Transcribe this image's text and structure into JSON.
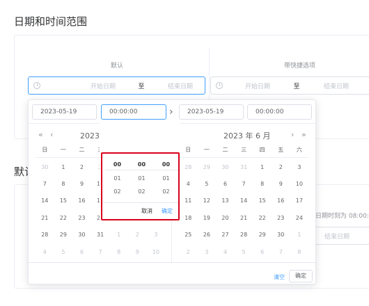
{
  "section1": {
    "title": "日期和时间范围"
  },
  "section2": {
    "title": "默认"
  },
  "demos": {
    "default_label": "默认",
    "shortcut_label": "带快捷选项",
    "start_placeholder": "开始日期",
    "separator": "至",
    "end_placeholder": "结束日期",
    "peek_text": "日期时刻为 08:00:0",
    "peek_end": "结束日期"
  },
  "picker": {
    "start_date": "2023-05-19",
    "start_time": "00:00:00",
    "end_date": "2023-05-19",
    "end_time": "00:00:00",
    "left_title": "2023 年",
    "right_title": "2023 年 6 月",
    "weekdays": [
      "日",
      "一",
      "二",
      "三",
      "四",
      "五",
      "六"
    ],
    "left_grid": [
      [
        "30",
        "1",
        "2",
        "3",
        "4",
        "5",
        "6"
      ],
      [
        "7",
        "8",
        "9",
        "10",
        "11",
        "12",
        "13"
      ],
      [
        "14",
        "15",
        "16",
        "17",
        "18",
        "19",
        "20"
      ],
      [
        "21",
        "22",
        "23",
        "24",
        "25",
        "26",
        "27"
      ],
      [
        "28",
        "29",
        "30",
        "31",
        "1",
        "2",
        "3"
      ],
      [
        "4",
        "5",
        "6",
        "7",
        "8",
        "9",
        "10"
      ]
    ],
    "right_grid": [
      [
        "28",
        "29",
        "30",
        "31",
        "1",
        "2",
        "3"
      ],
      [
        "4",
        "5",
        "6",
        "7",
        "8",
        "9",
        "10"
      ],
      [
        "11",
        "12",
        "13",
        "14",
        "15",
        "16",
        "17"
      ],
      [
        "18",
        "19",
        "20",
        "21",
        "22",
        "23",
        "24"
      ],
      [
        "25",
        "26",
        "27",
        "28",
        "29",
        "30",
        "1"
      ],
      [
        "2",
        "3",
        "4",
        "5",
        "6",
        "7",
        "8"
      ]
    ],
    "clear_label": "清空",
    "ok_label": "确定",
    "nav": {
      "prev_year": "«",
      "prev_month": "‹",
      "next_month": "›",
      "next_year": "»",
      "range_arrow": "›"
    }
  },
  "time_spinner": {
    "hours": [
      "00",
      "01",
      "02"
    ],
    "minutes": [
      "00",
      "01",
      "02"
    ],
    "seconds": [
      "00",
      "01",
      "02"
    ],
    "cancel_label": "取消",
    "confirm_label": "确定"
  },
  "colors": {
    "accent": "#409eff",
    "highlight_frame": "#d9001b"
  }
}
